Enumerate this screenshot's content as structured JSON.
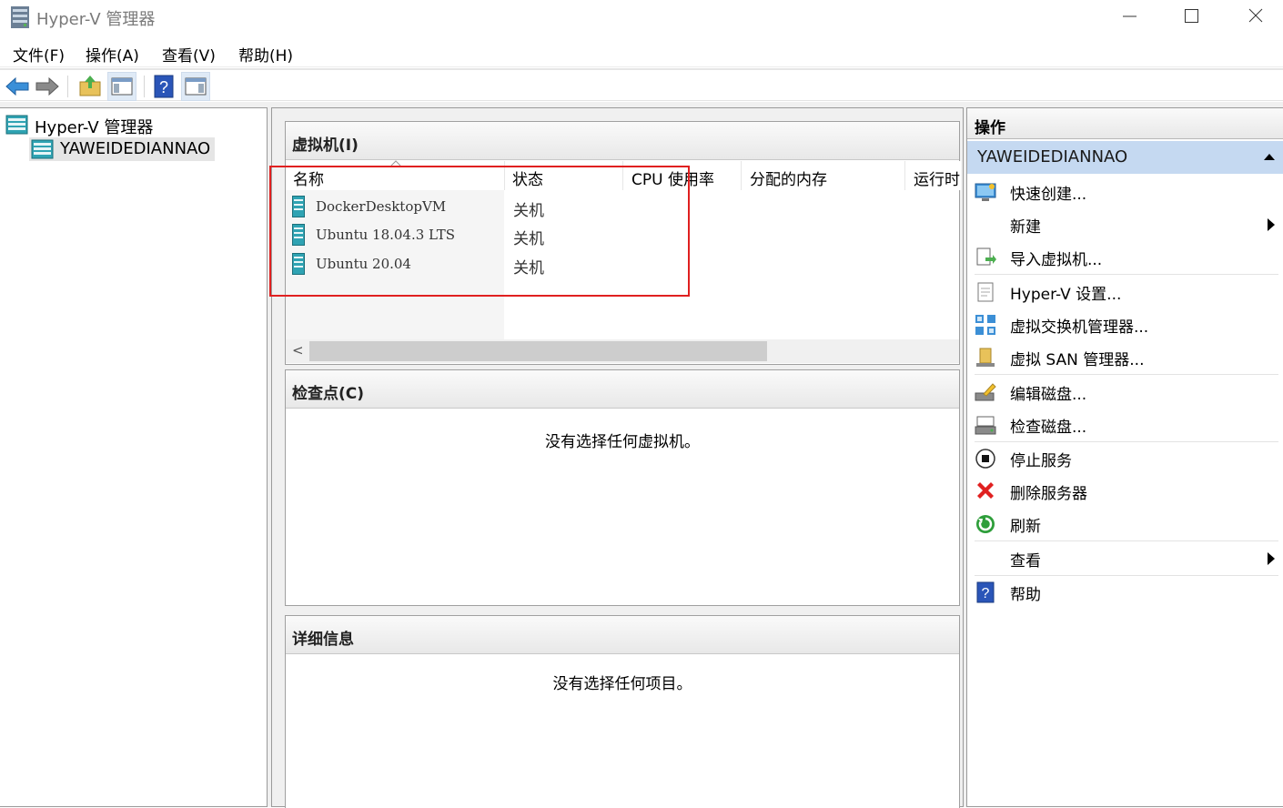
{
  "window": {
    "title": "Hyper-V 管理器"
  },
  "menu": [
    "文件(F)",
    "操作(A)",
    "查看(V)",
    "帮助(H)"
  ],
  "tree": {
    "root": "Hyper-V 管理器",
    "server": "YAWEIDEDIANNAO"
  },
  "vm_section": {
    "title": "虚拟机(I)",
    "columns": [
      "名称",
      "状态",
      "CPU 使用率",
      "分配的内存",
      "运行时"
    ],
    "rows": [
      {
        "name": "DockerDesktopVM",
        "state": "关机"
      },
      {
        "name": "Ubuntu 18.04.3 LTS",
        "state": "关机"
      },
      {
        "name": "Ubuntu 20.04",
        "state": "关机"
      }
    ],
    "scroll_left_glyph": "<"
  },
  "checkpoint_section": {
    "title": "检查点(C)",
    "message": "没有选择任何虚拟机。"
  },
  "details_section": {
    "title": "详细信息",
    "message": "没有选择任何项目。"
  },
  "actions": {
    "title": "操作",
    "server": "YAWEIDEDIANNAO",
    "items": [
      {
        "label": "快速创建...",
        "icon": "quick-create-icon"
      },
      {
        "label": "新建",
        "icon": "none",
        "submenu": true
      },
      {
        "label": "导入虚拟机...",
        "icon": "import-icon"
      },
      {
        "label": "Hyper-V 设置...",
        "icon": "settings-page-icon"
      },
      {
        "label": "虚拟交换机管理器...",
        "icon": "switch-icon"
      },
      {
        "label": "虚拟 SAN 管理器...",
        "icon": "san-icon"
      },
      {
        "label": "编辑磁盘...",
        "icon": "edit-disk-icon"
      },
      {
        "label": "检查磁盘...",
        "icon": "inspect-disk-icon"
      },
      {
        "label": "停止服务",
        "icon": "stop-icon"
      },
      {
        "label": "删除服务器",
        "icon": "delete-icon"
      },
      {
        "label": "刷新",
        "icon": "refresh-icon"
      },
      {
        "label": "查看",
        "icon": "none",
        "submenu": true
      },
      {
        "label": "帮助",
        "icon": "help-icon"
      }
    ]
  },
  "colors": {
    "highlight_box": "#e02020",
    "server_header_bg": "#c5d9f1",
    "selected_tree_bg": "#e5e5e5"
  }
}
